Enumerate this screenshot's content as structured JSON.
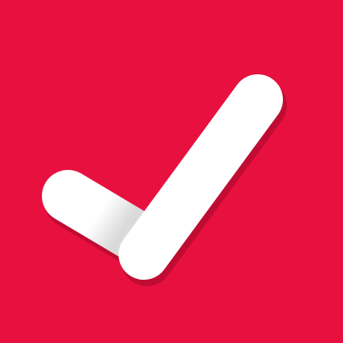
{
  "icon": {
    "name": "checkmark-icon",
    "background_color": "#E8103F",
    "mark_color": "#FFFFFF",
    "mark_shade_color": "#DADADA",
    "shadow_color": "#A10A2B"
  }
}
